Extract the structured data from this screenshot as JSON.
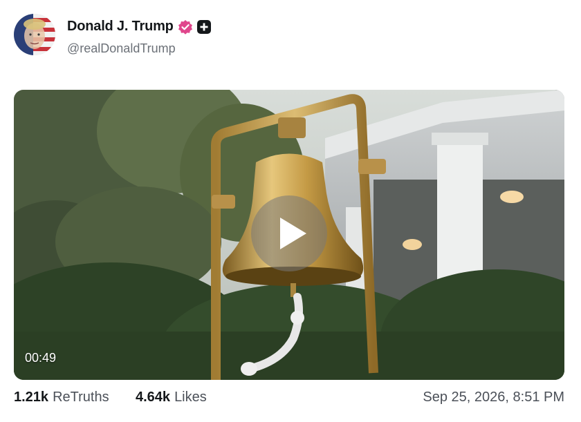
{
  "post": {
    "author": {
      "display_name": "Donald J. Trump",
      "handle": "@realDonaldTrump",
      "avatar_icon": "profile-avatar",
      "verified_icon": "verified-badge-icon",
      "verified_color": "#e0468c",
      "follow_icon": "plus-icon"
    },
    "media": {
      "type": "video",
      "duration": "00:49",
      "play_icon": "play-icon"
    },
    "stats": {
      "retruths_count": "1.21k",
      "retruths_label": "ReTruths",
      "likes_count": "4.64k",
      "likes_label": "Likes"
    },
    "timestamp": "Sep 25, 2026, 8:51 PM"
  }
}
